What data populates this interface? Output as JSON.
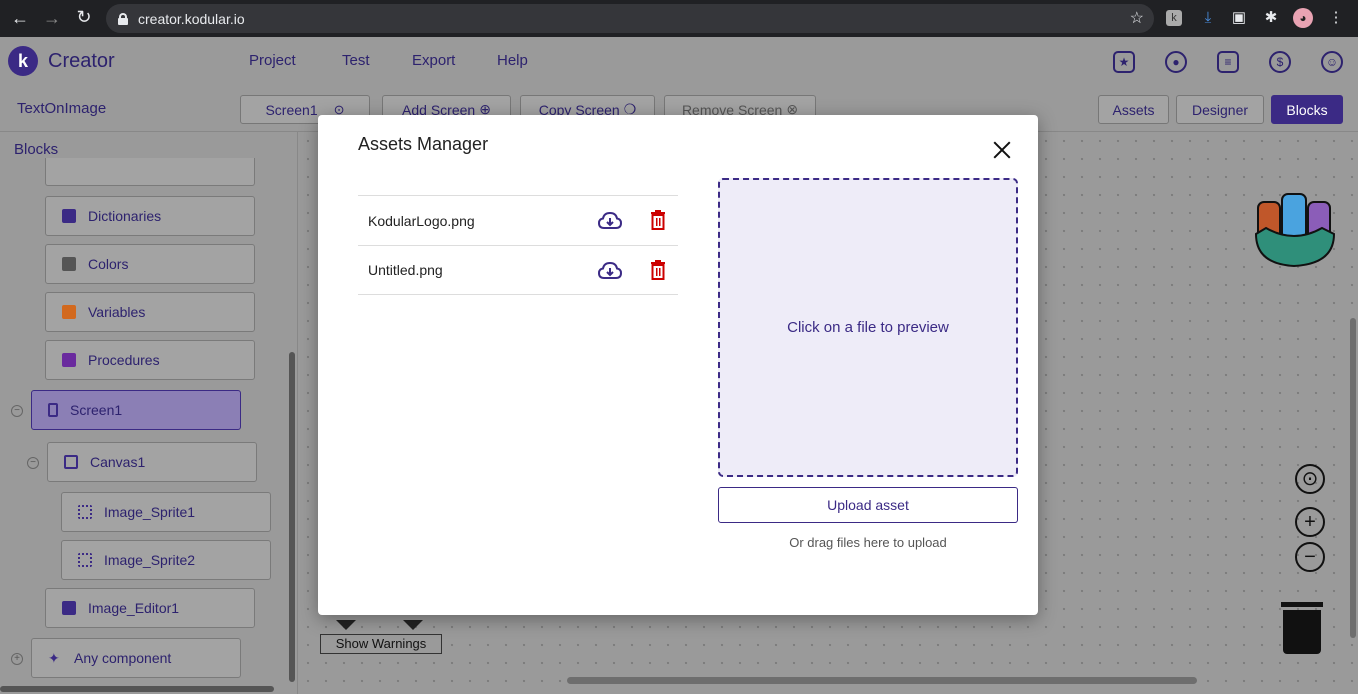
{
  "browser": {
    "url": "creator.kodular.io"
  },
  "app": {
    "logo_letter": "k",
    "brand": "Creator"
  },
  "menu": [
    "Project",
    "Test",
    "Export",
    "Help"
  ],
  "project": {
    "name": "TextOnImage"
  },
  "toolbar": {
    "screen_select": "Screen1",
    "add_screen": "Add Screen",
    "copy_screen": "Copy Screen",
    "remove_screen": "Remove Screen",
    "assets": "Assets",
    "designer": "Designer",
    "blocks": "Blocks"
  },
  "sidebar": {
    "title": "Blocks",
    "items": [
      {
        "label": "Dictionaries",
        "icon": "book-icon",
        "color": "#3b2a85"
      },
      {
        "label": "Colors",
        "icon": "paint-roller-icon",
        "color": "#555555"
      },
      {
        "label": "Variables",
        "icon": "variable-icon",
        "color": "#d2691e"
      },
      {
        "label": "Procedures",
        "icon": "clipboard-icon",
        "color": "#6a2a9e"
      },
      {
        "label": "Screen1",
        "icon": "phone-icon",
        "color": "#3b2a85"
      },
      {
        "label": "Canvas1",
        "icon": "square-icon",
        "color": "#3b2a85"
      },
      {
        "label": "Image_Sprite1",
        "icon": "sprite-icon",
        "color": "#3b2a85"
      },
      {
        "label": "Image_Sprite2",
        "icon": "sprite-icon",
        "color": "#3b2a85"
      },
      {
        "label": "Image_Editor1",
        "icon": "image-icon",
        "color": "#3b2a85"
      },
      {
        "label": "Any component",
        "icon": "sparkle-icon",
        "color": "#3b2a85"
      }
    ]
  },
  "workspace": {
    "warnings_button": "Show Warnings"
  },
  "modal": {
    "title": "Assets Manager",
    "assets": [
      {
        "name": "KodularLogo.png"
      },
      {
        "name": "Untitled.png"
      }
    ],
    "preview_text": "Click on a file to preview",
    "upload_label": "Upload asset",
    "drag_text": "Or drag files here to upload"
  }
}
